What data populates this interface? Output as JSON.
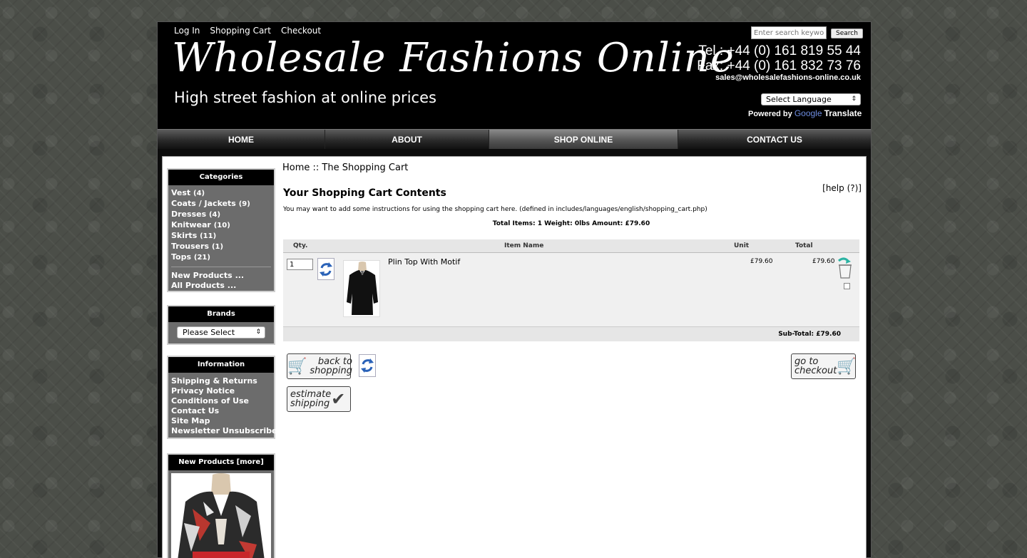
{
  "header": {
    "links": [
      "Log In",
      "Shopping Cart",
      "Checkout"
    ],
    "logo": "Wholesale Fashions Online",
    "tagline": "High street fashion at online prices",
    "search_placeholder": "Enter search keywords",
    "search_button": "Search",
    "tel": "Tel : +44 (0) 161 819 55 44",
    "fax": "Fax: +44 (0) 161 832 73 76",
    "email": "sales@wholesalefashions-online.co.uk",
    "language_select": "Select Language",
    "powered_by": "Powered by",
    "google": "Google",
    "translate": "Translate"
  },
  "nav": {
    "tabs": [
      "HOME",
      "ABOUT",
      "SHOP ONLINE",
      "CONTACT US"
    ],
    "active": "SHOP ONLINE"
  },
  "sidebar": {
    "categories": {
      "title": "Categories",
      "items": [
        {
          "label": "Vest",
          "count": "(4)"
        },
        {
          "label": "Coats / Jackets",
          "count": "(9)"
        },
        {
          "label": "Dresses",
          "count": "(4)"
        },
        {
          "label": "Knitwear",
          "count": "(10)"
        },
        {
          "label": "Skirts",
          "count": "(11)"
        },
        {
          "label": "Trousers",
          "count": "(1)"
        },
        {
          "label": "Tops",
          "count": "(21)"
        }
      ],
      "extra": [
        "New Products ...",
        "All Products ..."
      ]
    },
    "brands": {
      "title": "Brands",
      "select": "Please Select"
    },
    "information": {
      "title": "Information",
      "items": [
        "Shipping & Returns",
        "Privacy Notice",
        "Conditions of Use",
        "Contact Us",
        "Site Map",
        "Newsletter Unsubscribe"
      ]
    },
    "new_products": {
      "title": "New Products  [more]"
    }
  },
  "main": {
    "breadcrumb": "Home ::  The Shopping Cart",
    "title": "Your Shopping Cart Contents",
    "help": "[help (?)]",
    "instructions": "You may want to add some instructions for using the shopping cart here. (defined in includes/languages/english/shopping_cart.php)",
    "totals": "Total Items: 1  Weight: 0lbs  Amount: £79.60",
    "columns": {
      "qty": "Qty.",
      "item": "Item Name",
      "unit": "Unit",
      "total": "Total"
    },
    "item": {
      "qty": "1",
      "name": "Plin Top With Motif",
      "unit": "£79.60",
      "total": "£79.60"
    },
    "subtotal": "Sub-Total: £79.60",
    "buttons": {
      "back_line1": "back to",
      "back_line2": "shopping",
      "checkout_line1": "go to",
      "checkout_line2": "checkout",
      "estimate_line1": "estimate",
      "estimate_line2": "shipping"
    }
  }
}
